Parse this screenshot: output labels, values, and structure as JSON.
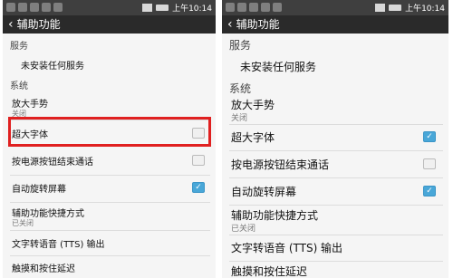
{
  "status": {
    "time": "上午10:14"
  },
  "header": {
    "back_icon": "‹",
    "title": "辅助功能"
  },
  "sections": {
    "services": "服务",
    "system": "系统"
  },
  "items": {
    "no_service": "未安装任何服务",
    "magnify": {
      "label": "放大手势",
      "sub": "关闭"
    },
    "large_font": {
      "label": "超大字体"
    },
    "power_end_call": {
      "label": "按电源按钮结束通话"
    },
    "auto_rotate": {
      "label": "自动旋转屏幕"
    },
    "shortcut": {
      "label": "辅助功能快捷方式",
      "sub": "已关闭"
    },
    "tts": {
      "label": "文字转语音 (TTS) 输出"
    },
    "touch_hold": {
      "label": "触摸和按住延迟"
    }
  },
  "states": {
    "left": {
      "large_font": false,
      "power_end_call": false,
      "auto_rotate": true
    },
    "right": {
      "large_font": true,
      "power_end_call": false,
      "auto_rotate": true
    }
  },
  "colors": {
    "accent": "#49a7d8",
    "highlight": "#e02020",
    "appbar": "#2a2a2a"
  }
}
